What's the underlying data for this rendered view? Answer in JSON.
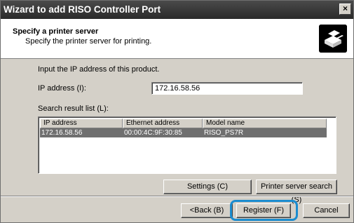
{
  "window": {
    "title": "Wizard to add RISO Controller Port",
    "close_glyph": "×"
  },
  "header": {
    "title": "Specify a printer server",
    "subtitle": "Specify the printer server for printing.",
    "icon": "printer-network-icon"
  },
  "form": {
    "intro": "Input the IP address of this product.",
    "ip_label": "IP address (I):",
    "ip_value": "172.16.58.56",
    "search_label": "Search result list (L):"
  },
  "list": {
    "columns": [
      "IP address",
      "Ethernet address",
      "Model name"
    ],
    "rows": [
      {
        "ip": "172.16.58.56",
        "mac": "00:00:4C:9F:30:85",
        "model": "RISO_PS7R",
        "selected": true
      }
    ]
  },
  "buttons": {
    "settings": "Settings (C)",
    "server_search": "Printer server search (S)",
    "back": "<Back (B)",
    "register": "Register (F)",
    "cancel": "Cancel"
  },
  "colors": {
    "highlight": "#1b8ccf",
    "selection": "#6f6f6f"
  }
}
